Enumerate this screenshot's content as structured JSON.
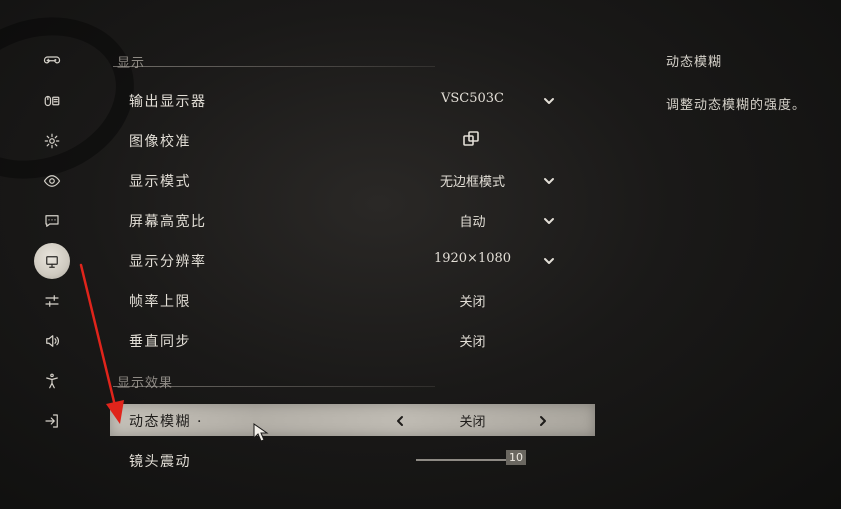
{
  "sidebar": {
    "items": [
      {
        "icon": "gamepad-icon"
      },
      {
        "icon": "mouse-keyboard-icon"
      },
      {
        "icon": "gear-icon"
      },
      {
        "icon": "eye-icon"
      },
      {
        "icon": "chat-icon"
      },
      {
        "icon": "monitor-icon",
        "active": true
      },
      {
        "icon": "sliders-icon"
      },
      {
        "icon": "speaker-icon"
      },
      {
        "icon": "accessibility-icon"
      },
      {
        "icon": "exit-icon"
      }
    ]
  },
  "sections": {
    "display": {
      "title": "显示",
      "rows": [
        {
          "label": "输出显示器",
          "value": "VSC503C"
        },
        {
          "label": "图像校准",
          "value": ""
        },
        {
          "label": "显示模式",
          "value": "无边框模式"
        },
        {
          "label": "屏幕高宽比",
          "value": "自动"
        },
        {
          "label": "显示分辨率",
          "value": "1920×1080"
        },
        {
          "label": "帧率上限",
          "value": "关闭"
        },
        {
          "label": "垂直同步",
          "value": "关闭"
        }
      ]
    },
    "effects": {
      "title": "显示效果",
      "rows": [
        {
          "label": "动态模糊 ·",
          "value": "关闭"
        },
        {
          "label": "镜头震动",
          "value": "10",
          "slider_fraction": 1.0
        }
      ]
    }
  },
  "description": {
    "title": "动态模糊",
    "body": "调整动态模糊的强度。"
  },
  "colors": {
    "annotation_arrow": "#e0241b",
    "selected_row": "#bdb9b1"
  }
}
